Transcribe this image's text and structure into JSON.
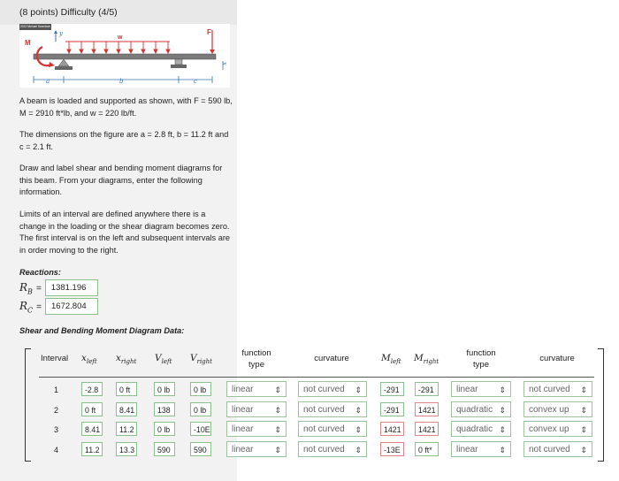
{
  "question": {
    "title": "(8 points) Difficulty (4/5)",
    "copyright": "2013 Michael Swanbom",
    "figure_labels": {
      "y": "y",
      "w": "w",
      "F": "F",
      "M": "M",
      "x": "x",
      "a": "a",
      "b": "b",
      "c": "c"
    },
    "p1": "A beam is loaded and supported as shown, with F = 590 lb, M = 2910 ft*lb, and w = 220 lb/ft.",
    "p2": "The dimensions on the figure are a = 2.8 ft, b = 11.2 ft and c = 2.1 ft.",
    "p3": "Draw and label shear and bending moment diagrams for this beam. From your diagrams, enter the following information.",
    "p4": "Limits of an interval are defined anywhere there is a change in the loading or the shear diagram becomes zero. The first interval is on the left and subsequent intervals are in order moving to the right."
  },
  "reactions": {
    "heading": "Reactions:",
    "rb_label": "R",
    "rb_sub": "B",
    "rb_value": "1381.196",
    "rc_label": "R",
    "rc_sub": "C",
    "rc_value": "1672.804",
    "eq": "="
  },
  "table": {
    "heading": "Shear and Bending Moment Diagram Data:",
    "headers": {
      "interval": "Interval",
      "x_left": "x",
      "x_left_sub": "left",
      "x_right": "x",
      "x_right_sub": "right",
      "v_left": "V",
      "v_left_sub": "left",
      "v_right": "V",
      "v_right_sub": "right",
      "function_type_1": "function type",
      "curvature_1": "curvature",
      "m_left": "M",
      "m_left_sub": "left",
      "m_right": "M",
      "m_right_sub": "right",
      "function_type_2": "function type",
      "curvature_2": "curvature"
    },
    "rows": [
      {
        "interval": "1",
        "x_left": "-2.8",
        "x_right": "0 ft",
        "v_left": "0 lb",
        "v_right": "0 lb",
        "v_func": "linear",
        "v_curv": "not curved",
        "m_left": "-291",
        "m_right": "-291",
        "m_func": "linear",
        "m_curv": "not curved"
      },
      {
        "interval": "2",
        "x_left": "0 ft",
        "x_right": "8.41",
        "v_left": "138",
        "v_right": "0 lb",
        "v_func": "linear",
        "v_curv": "not curved",
        "m_left": "-291",
        "m_right": "1421",
        "m_func": "quadratic",
        "m_curv": "convex up"
      },
      {
        "interval": "3",
        "x_left": "8.41",
        "x_right": "11.2",
        "v_left": "0 lb",
        "v_right": "-10E",
        "v_func": "linear",
        "v_curv": "not curved",
        "m_left": "1421",
        "m_right": "1421",
        "m_func": "quadratic",
        "m_curv": "convex up"
      },
      {
        "interval": "4",
        "x_left": "11.2",
        "x_right": "13.3",
        "v_left": "590",
        "v_right": "590",
        "v_func": "linear",
        "v_curv": "not curved",
        "m_left": "-13E",
        "m_right": "0 ft*",
        "m_func": "linear",
        "m_curv": "not curved"
      }
    ]
  },
  "colors": {
    "correct_border": "#8cc08c",
    "incorrect_border": "#dd8888",
    "panel": "#f2f2f2",
    "load": "#d33333"
  }
}
